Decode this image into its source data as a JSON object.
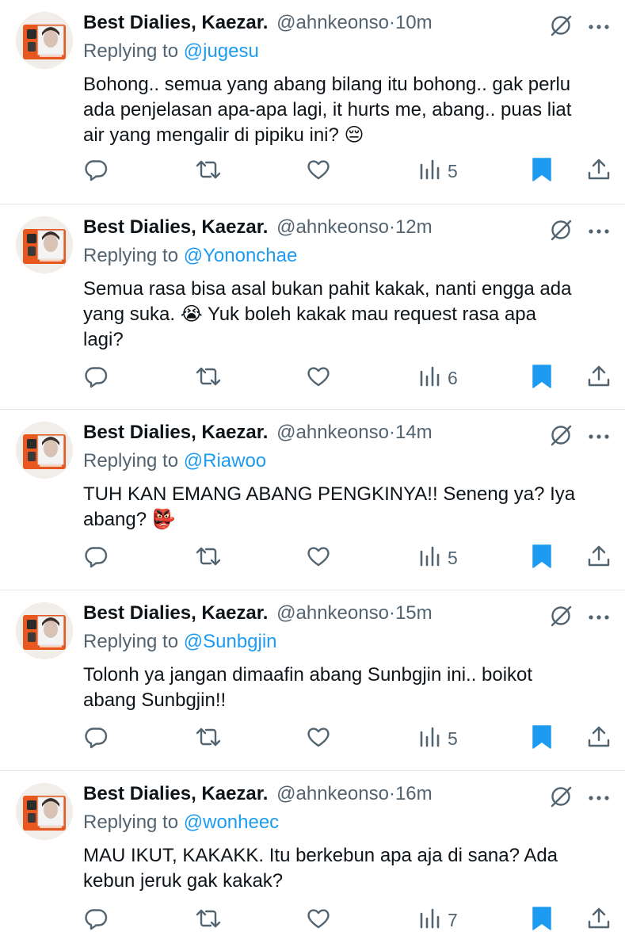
{
  "tweets": [
    {
      "name": "Best Dialies, Kaezar.",
      "handle": "@ahnkeonso",
      "dot": "·",
      "time": "10m",
      "replying_label": "Replying to",
      "replying_to": "@jugesu",
      "text": "Bohong.. semua yang abang bilang itu bohong.. gak perlu\nada penjelasan apa-apa lagi, it hurts me, abang.. puas liat\nair yang mengalir di pipiku ini? 😔",
      "views": "5"
    },
    {
      "name": "Best Dialies, Kaezar.",
      "handle": "@ahnkeonso",
      "dot": "·",
      "time": "12m",
      "replying_label": "Replying to",
      "replying_to": "@Yononchae",
      "text": "Semua rasa bisa asal bukan pahit kakak, nanti engga ada\nyang suka. 😭 Yuk boleh kakak mau request rasa apa\nlagi?",
      "views": "6"
    },
    {
      "name": "Best Dialies, Kaezar.",
      "handle": "@ahnkeonso",
      "dot": "·",
      "time": "14m",
      "replying_label": "Replying to",
      "replying_to": "@Riawoo",
      "text": "TUH KAN EMANG ABANG PENGKINYA!! Seneng ya? Iya\nabang? 👺",
      "views": "5"
    },
    {
      "name": "Best Dialies, Kaezar.",
      "handle": "@ahnkeonso",
      "dot": "·",
      "time": "15m",
      "replying_label": "Replying to",
      "replying_to": "@Sunbgjin",
      "text": "Tolonh ya jangan dimaafin abang Sunbgjin ini.. boikot\nabang Sunbgjin!!",
      "views": "5"
    },
    {
      "name": "Best Dialies, Kaezar.",
      "handle": "@ahnkeonso",
      "dot": "·",
      "time": "16m",
      "replying_label": "Replying to",
      "replying_to": "@wonheec",
      "text": "MAU IKUT, KAKAKK. Itu berkebun apa aja di sana? Ada\nkebun jeruk gak kakak?",
      "views": "7"
    }
  ],
  "colors": {
    "text": "#0f1419",
    "secondary": "#536471",
    "mention": "#1d9bf0",
    "bookmark_filled": "#1d9bf0",
    "divider": "#e6e9ec",
    "avatar_accent": "#e8571e"
  },
  "icons": [
    "reply-icon",
    "retweet-icon",
    "like-icon",
    "views-icon",
    "bookmark-icon",
    "share-icon",
    "grok-icon",
    "more-icon"
  ]
}
